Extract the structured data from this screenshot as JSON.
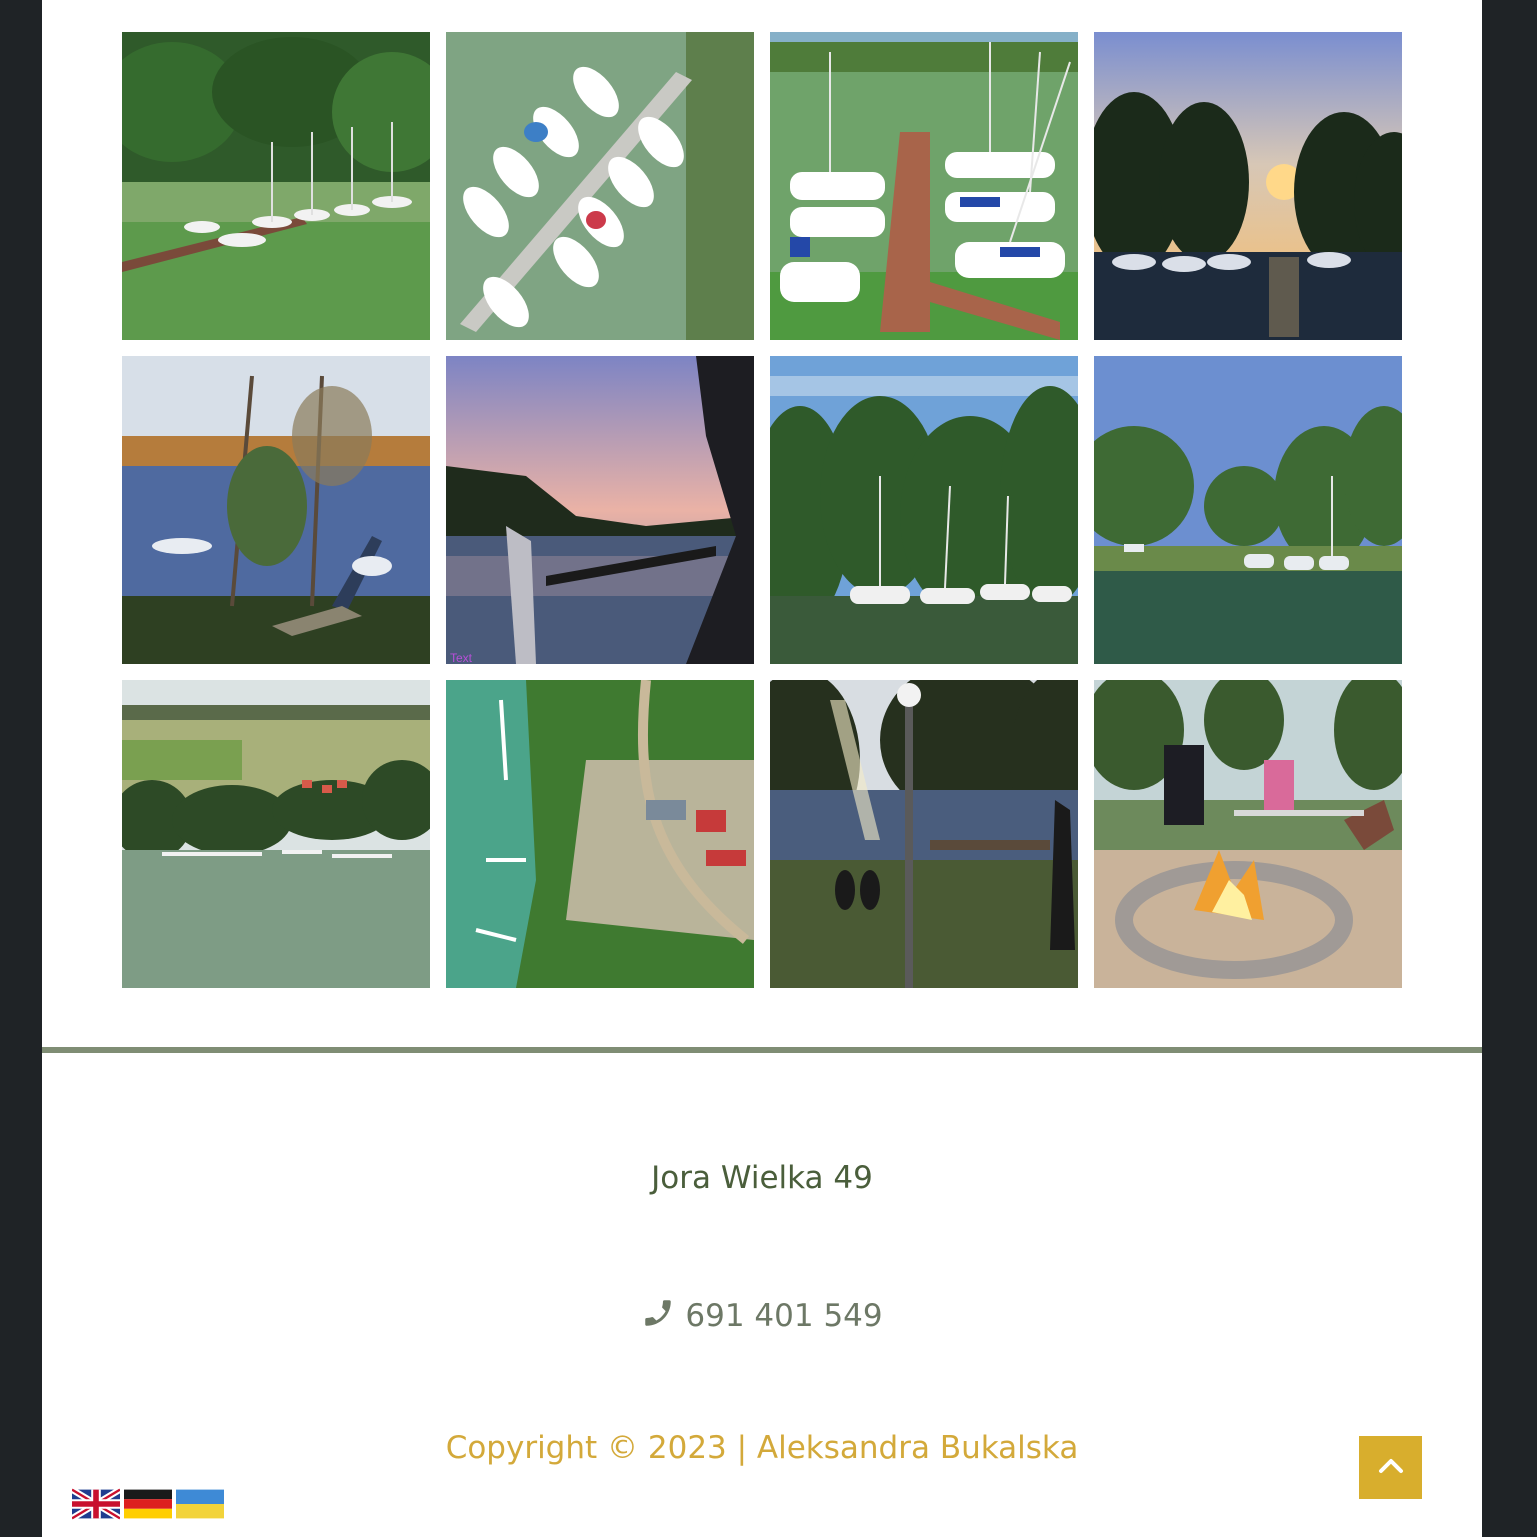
{
  "footer": {
    "address": "Jora Wielka 49",
    "phone": "691 401 549",
    "copyright": "Copyright © 2023 | Aleksandra Bukalska"
  },
  "icons": {
    "phone": "phone-icon",
    "back_to_top": "chevron-up-icon"
  },
  "language_flags": [
    {
      "code": "en",
      "label": "English"
    },
    {
      "code": "de",
      "label": "Deutsch"
    },
    {
      "code": "uk",
      "label": "Українська"
    }
  ],
  "gallery_watermark": "Text",
  "colors": {
    "page_background": "#1f2326",
    "divider": "#7f8d74",
    "address_text": "#4a5e3b",
    "phone_text": "#6d7866",
    "copyright_text": "#d3a93a",
    "back_to_top_button": "#d8ae2d"
  }
}
